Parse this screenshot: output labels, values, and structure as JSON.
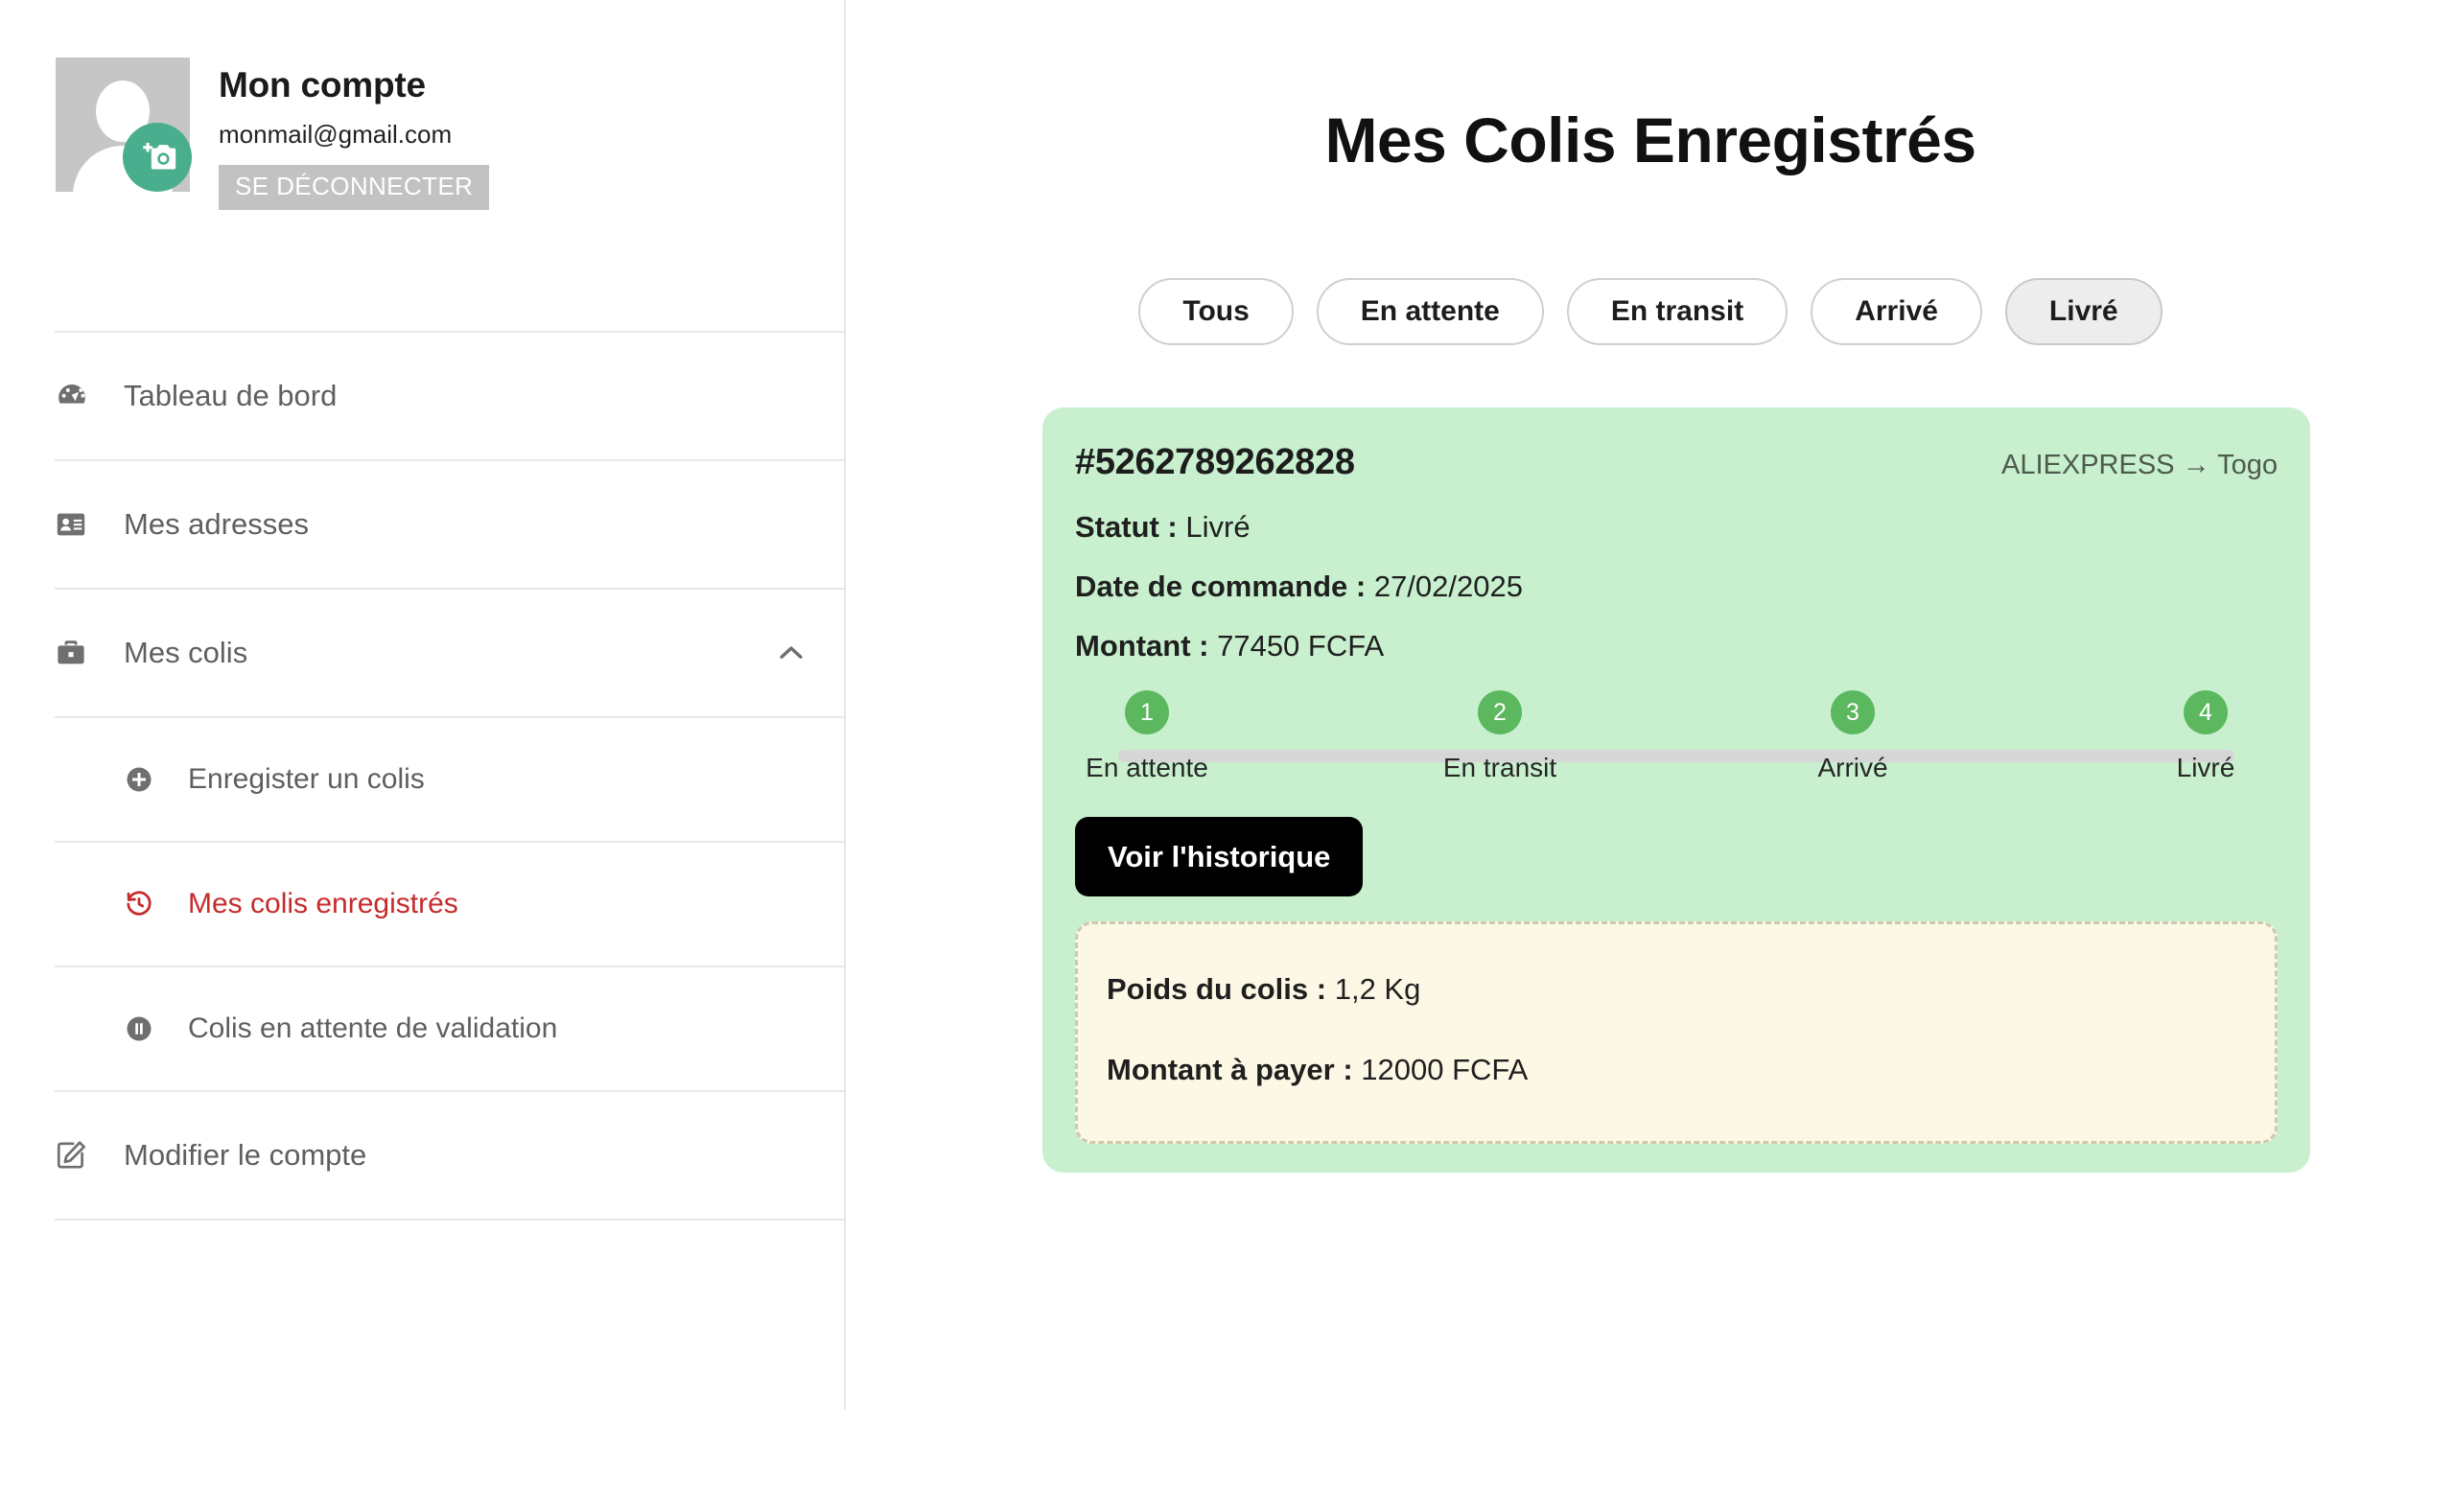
{
  "sidebar": {
    "account": {
      "title": "Mon compte",
      "email": "monmail@gmail.com",
      "logout_label": "SE DÉCONNECTER",
      "avatar_icon": "user-avatar-placeholder",
      "camera_icon": "add-photo-icon"
    },
    "items": [
      {
        "label": "Tableau de bord",
        "icon": "dashboard-icon",
        "key": "tableau-de-bord"
      },
      {
        "label": "Mes adresses",
        "icon": "address-card-icon",
        "key": "mes-adresses"
      },
      {
        "label": "Mes colis",
        "icon": "briefcase-icon",
        "key": "mes-colis",
        "chevron": "chevron-up-icon"
      }
    ],
    "sub_items": [
      {
        "label": "Enregister un colis",
        "icon": "plus-circle-icon",
        "key": "enregister-un-colis",
        "active": false
      },
      {
        "label": "Mes colis enregistrés",
        "icon": "history-icon",
        "key": "mes-colis-enregistres",
        "active": true
      },
      {
        "label": "Colis en attente de validation",
        "icon": "pause-circle-icon",
        "key": "colis-en-attente-de-validation",
        "active": false
      }
    ],
    "footer_items": [
      {
        "label": "Modifier le compte",
        "icon": "edit-square-icon",
        "key": "modifier-le-compte"
      }
    ]
  },
  "main": {
    "title": "Mes Colis Enregistrés",
    "filters": [
      {
        "label": "Tous",
        "active": false
      },
      {
        "label": "En attente",
        "active": false
      },
      {
        "label": "En transit",
        "active": false
      },
      {
        "label": "Arrivé",
        "active": false
      },
      {
        "label": "Livré",
        "active": true
      }
    ],
    "parcel": {
      "tracking_number": "#5262789262828",
      "route": "ALIEXPRESS → Togo",
      "status_label": "Statut :",
      "status_value": "Livré",
      "order_date_label": "Date de commande :",
      "order_date_value": "27/02/2025",
      "amount_label": "Montant :",
      "amount_value": "77450 FCFA",
      "history_button": "Voir l'historique",
      "steps": [
        {
          "number": "1",
          "label": "En attente"
        },
        {
          "number": "2",
          "label": "En transit"
        },
        {
          "number": "3",
          "label": "Arrivé"
        },
        {
          "number": "4",
          "label": "Livré"
        }
      ],
      "note": {
        "weight_label": "Poids du colis :",
        "weight_value": "1,2 Kg",
        "payable_label": "Montant à payer :",
        "payable_value": "12000 FCFA"
      }
    }
  },
  "colors": {
    "card_green": "#C8F0CE",
    "note_yellow": "#FDF8E5",
    "step_green": "#5CB85F",
    "accent_red": "#C62B2B",
    "camera_teal": "#48AE8D",
    "logout_gray": "#C2C2C2"
  }
}
